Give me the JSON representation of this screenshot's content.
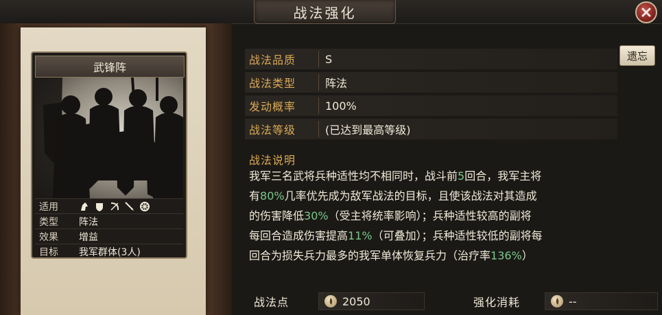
{
  "window": {
    "title": "战法强化"
  },
  "card": {
    "name": "武锋阵",
    "rows": [
      {
        "key": "适用"
      },
      {
        "key": "类型",
        "value": "阵法"
      },
      {
        "key": "效果",
        "value": "增益"
      },
      {
        "key": "目标",
        "value": "我军群体(3人)"
      }
    ],
    "unit_icons": [
      "cavalry-icon",
      "shield-icon",
      "bow-icon",
      "spear-icon",
      "siege-icon"
    ]
  },
  "info": {
    "quality": {
      "key": "战法品质",
      "value": "S"
    },
    "type": {
      "key": "战法类型",
      "value": "阵法"
    },
    "rate": {
      "key": "发动概率",
      "value": "100%"
    },
    "level": {
      "key": "战法等级",
      "value": "(已达到最高等级)"
    }
  },
  "buttons": {
    "recast": "遗忘"
  },
  "description": {
    "title": "战法说明",
    "line1_a": "我军三名武将兵种适性均不相同时，战斗前",
    "line1_b": "5",
    "line1_c": "回合，我军主将",
    "line2_a": "有",
    "line2_b": "80%",
    "line2_c": "几率优先成为敌军战法的目标，且使该战法对其造成",
    "line3_a": "的伤害降低",
    "line3_b": "30%",
    "line3_c": "（受主将统率影响）；兵种适性较高的副将",
    "line4_a": "每回合造成伤害提高",
    "line4_b": "11%",
    "line4_c": "（可叠加）；兵种适性较低的副将每",
    "line5_a": "回合为损失兵力最多的我军单体恢复兵力（治疗率",
    "line5_b": "136%",
    "line5_c": "）"
  },
  "footer": {
    "points_label": "战法点",
    "points_value": "2050",
    "cost_label": "强化消耗",
    "cost_value": "--"
  },
  "colors": {
    "accent_gold": "#d9a955",
    "highlight_green": "#79c98a"
  }
}
